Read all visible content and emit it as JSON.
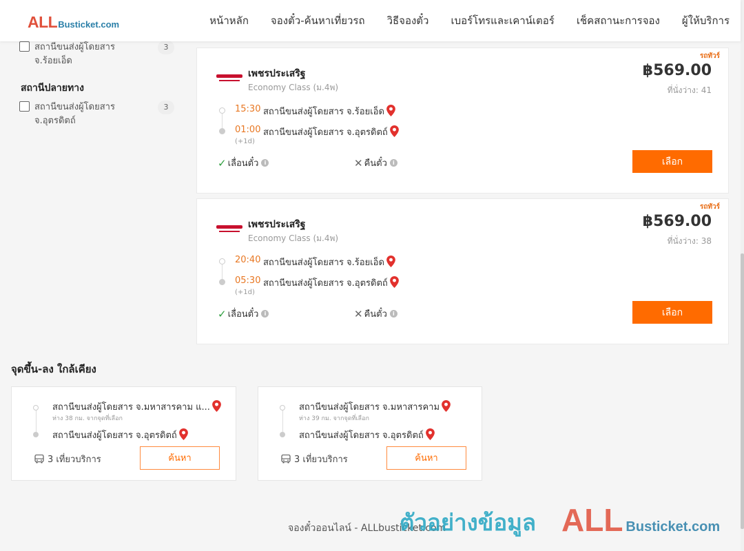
{
  "header": {
    "logo_all": "ALL",
    "logo_rest": "Busticket.com",
    "nav": [
      "หน้าหลัก",
      "จองตั๋ว-ค้นหาเที่ยวรถ",
      "วิธีจองตั๋ว",
      "เบอร์โทรและเคาน์เตอร์",
      "เช็คสถานะการจอง",
      "ผู้ให้บริการ"
    ]
  },
  "sidebar": {
    "origin_filter": {
      "label": "สถานีขนส่งผู้โดยสาร จ.ร้อยเอ็ด",
      "count": "3"
    },
    "destination_heading": "สถานีปลายทาง",
    "destination_filter": {
      "label": "สถานีขนส่งผู้โดยสาร จ.อุตรดิตถ์",
      "count": "3"
    }
  },
  "trips": [
    {
      "vip": "รถทัวร์",
      "operator": "เพชรประเสริฐ",
      "class": "Economy Class (ม.4พ)",
      "price": "฿569.00",
      "seats": "ที่นั่งว่าง: 41",
      "depart_time": "15:30",
      "depart_station": "สถานีขนส่งผู้โดยสาร จ.ร้อยเอ็ด",
      "arrive_time": "01:00",
      "arrive_station": "สถานีขนส่งผู้โดยสาร จ.อุตรดิตถ์",
      "next_day": "(+1d)",
      "reschedule": "เลื่อนตั๋ว",
      "refund": "คืนตั๋ว",
      "select": "เลือก"
    },
    {
      "vip": "รถทัวร์",
      "operator": "เพชรประเสริฐ",
      "class": "Economy Class (ม.4พ)",
      "price": "฿569.00",
      "seats": "ที่นั่งว่าง: 38",
      "depart_time": "20:40",
      "depart_station": "สถานีขนส่งผู้โดยสาร จ.ร้อยเอ็ด",
      "arrive_time": "05:30",
      "arrive_station": "สถานีขนส่งผู้โดยสาร จ.อุตรดิตถ์",
      "next_day": "(+1d)",
      "reschedule": "เลื่อนตั๋ว",
      "refund": "คืนตั๋ว",
      "select": "เลือก"
    }
  ],
  "nearby": {
    "title": "จุดขึ้น-ลง ใกล้เคียง",
    "cards": [
      {
        "from": "สถานีขนส่งผู้โดยสาร จ.มหาสารคาม แ...",
        "distance": "ห่าง 38 กม. จากจุดที่เลือก",
        "to": "สถานีขนส่งผู้โดยสาร จ.อุตรดิตถ์",
        "trips": "3 เที่ยวบริการ",
        "button": "ค้นหา"
      },
      {
        "from": "สถานีขนส่งผู้โดยสาร จ.มหาสารคาม",
        "distance": "ห่าง 39 กม. จากจุดที่เลือก",
        "to": "สถานีขนส่งผู้โดยสาร จ.อุตรดิตถ์",
        "trips": "3 เที่ยวบริการ",
        "button": "ค้นหา"
      }
    ]
  },
  "footer": {
    "text": "จองตั๋วออนไลน์ - ALLbusticket.com",
    "watermark": "ตัวอย่างข้อมูล",
    "watermark_logo_all": "ALL",
    "watermark_logo_rest": "Busticket.com"
  },
  "colors": {
    "accent": "#ff6b00",
    "time": "#e87722",
    "logo_red": "#e0513c",
    "logo_blue": "#2a7fa8",
    "check_green": "#2e9e3e",
    "watermark": "#2aa7c4"
  },
  "icons": [
    "map-pin-icon",
    "check-icon",
    "cross-icon",
    "info-icon",
    "bus-icon",
    "checkbox-icon"
  ]
}
